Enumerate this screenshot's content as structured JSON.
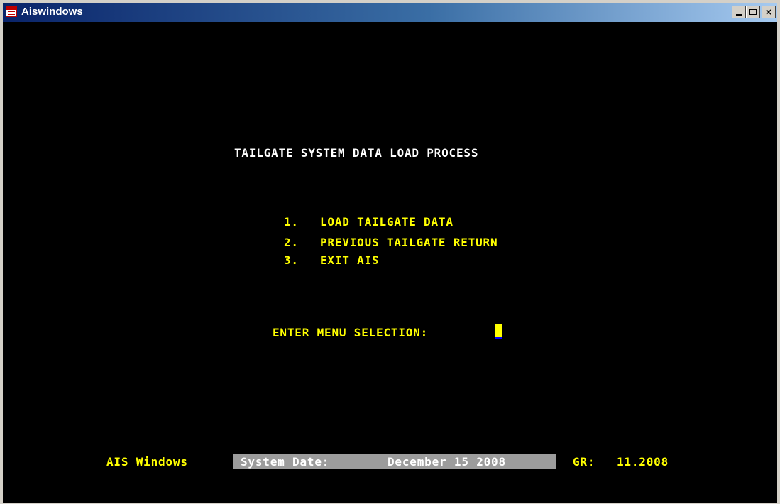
{
  "window": {
    "title": "Aiswindows",
    "controls": {
      "minimize": "minimize-button",
      "maximize": "maximize-button",
      "close": "×"
    }
  },
  "terminal": {
    "heading": "TAILGATE SYSTEM DATA LOAD PROCESS",
    "menu": [
      {
        "number": "1.",
        "label": "LOAD TAILGATE DATA"
      },
      {
        "number": "2.",
        "label": "PREVIOUS TAILGATE RETURN"
      },
      {
        "number": "3.",
        "label": "EXIT AIS"
      }
    ],
    "prompt": "ENTER MENU SELECTION:",
    "input_value": ""
  },
  "status_bar": {
    "app_name": "AIS Windows",
    "system_date_label": "System Date:",
    "system_date_value": "December 15 2008",
    "gr_label": "GR:",
    "gr_value": "11.2008"
  },
  "colors": {
    "terminal_background": "#000000",
    "heading_text": "#ffffff",
    "menu_text": "#ffff00",
    "status_box": "#9c9c9c",
    "cursor": "#ffff00"
  }
}
